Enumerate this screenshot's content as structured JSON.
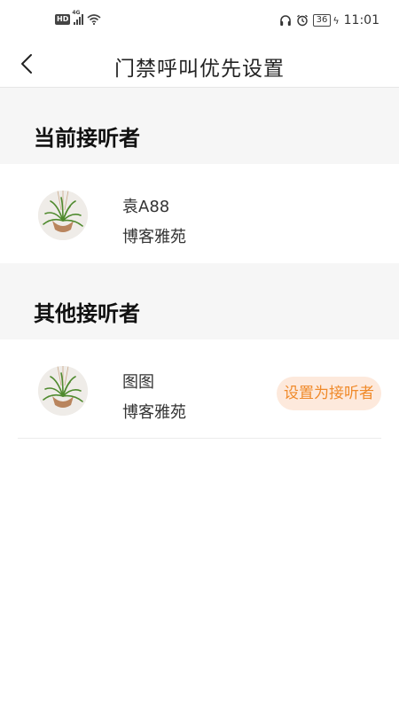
{
  "status_bar": {
    "network_badge": "HD",
    "network_gen": "4G",
    "battery": "36",
    "time": "11:01",
    "icons": [
      "signal-icon",
      "wifi-icon",
      "headphone-icon",
      "alarm-icon",
      "battery-icon",
      "charging-icon"
    ]
  },
  "header": {
    "title": "门禁呼叫优先设置",
    "back_icon": "chevron-left-icon"
  },
  "current_section": {
    "heading": "当前接听者",
    "items": [
      {
        "name": "袁A88",
        "place": "博客雅苑",
        "avatar": "plant-avatar"
      }
    ]
  },
  "other_section": {
    "heading": "其他接听者",
    "items": [
      {
        "name": "图图",
        "place": "博客雅苑",
        "avatar": "plant-avatar",
        "action_label": "设置为接听者"
      }
    ]
  },
  "colors": {
    "accent": "#f08a2a",
    "accent_bg": "#fde9dc",
    "section_bg": "#f6f6f6"
  }
}
